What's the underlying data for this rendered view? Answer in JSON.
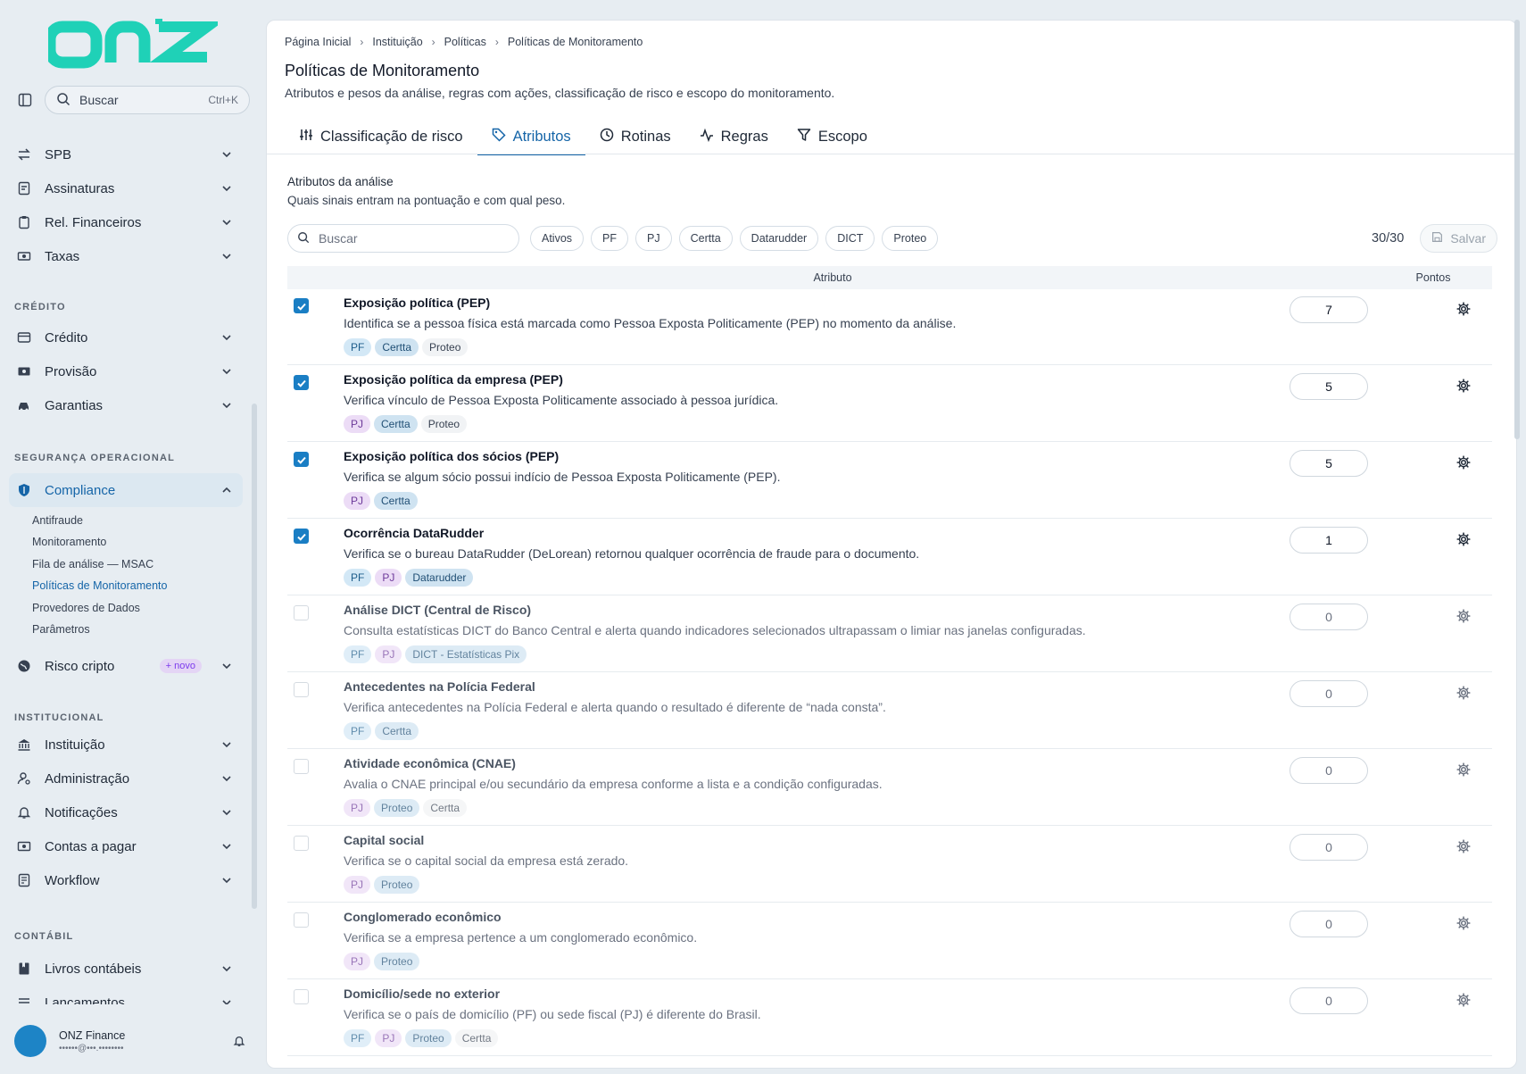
{
  "sidebar": {
    "logo_text": "onz",
    "search_label": "Buscar",
    "search_shortcut": "Ctrl+K",
    "top_items": [
      {
        "label": "SPB",
        "icon": "transfer-arrows-icon"
      },
      {
        "label": "Assinaturas",
        "icon": "signature-icon"
      },
      {
        "label": "Rel. Financeiros",
        "icon": "clipboard-icon"
      },
      {
        "label": "Taxas",
        "icon": "banknote-icon"
      }
    ],
    "section_credito": "CRÉDITO",
    "credito_items": [
      {
        "label": "Crédito",
        "icon": "card-icon"
      },
      {
        "label": "Provisão",
        "icon": "money-icon"
      },
      {
        "label": "Garantias",
        "icon": "car-icon"
      }
    ],
    "section_seguranca": "SEGURANÇA OPERACIONAL",
    "compliance_label": "Compliance",
    "compliance_sub": [
      "Antifraude",
      "Monitoramento",
      "Fila de análise — MSAC",
      "Políticas de Monitoramento",
      "Provedores de Dados",
      "Parâmetros"
    ],
    "risco_label": "Risco cripto",
    "risco_badge": "+ novo",
    "section_institucional": "INSTITUCIONAL",
    "institucional_items": [
      {
        "label": "Instituição",
        "icon": "bank-icon"
      },
      {
        "label": "Administração",
        "icon": "user-gear-icon"
      },
      {
        "label": "Notificações",
        "icon": "bell-icon"
      },
      {
        "label": "Contas a pagar",
        "icon": "bill-icon"
      },
      {
        "label": "Workflow",
        "icon": "workflow-icon"
      }
    ],
    "section_contabil": "CONTÁBIL",
    "contabil_items": [
      {
        "label": "Livros contábeis",
        "icon": "book-icon"
      },
      {
        "label": "Lançamentos",
        "icon": "list-icon"
      }
    ],
    "user_name": "ONZ Finance",
    "user_email": "••••••@•••.••••••••"
  },
  "breadcrumb": [
    "Página Inicial",
    "Instituição",
    "Políticas",
    "Políticas de Monitoramento"
  ],
  "page": {
    "title": "Políticas de Monitoramento",
    "subtitle": "Atributos e pesos da análise, regras com ações, classificação de risco e escopo do monitoramento."
  },
  "tabs": [
    {
      "label": "Classificação de risco",
      "icon": "sliders-icon"
    },
    {
      "label": "Atributos",
      "icon": "tag-icon"
    },
    {
      "label": "Rotinas",
      "icon": "clock-icon"
    },
    {
      "label": "Regras",
      "icon": "activity-icon"
    },
    {
      "label": "Escopo",
      "icon": "filter-icon"
    }
  ],
  "section": {
    "title": "Atributos da análise",
    "subtitle": "Quais sinais entram na pontuação e com qual peso."
  },
  "toolbar": {
    "search_placeholder": "Buscar",
    "chips": [
      "Ativos",
      "PF",
      "PJ",
      "Certta",
      "Datarudder",
      "DICT",
      "Proteo"
    ],
    "count": "30/30",
    "save_label": "Salvar"
  },
  "table": {
    "col_attr": "Atributo",
    "col_points": "Pontos",
    "rows": [
      {
        "title": "Exposição política (PEP)",
        "desc": "Identifica se a pessoa física está marcada como Pessoa Exposta Politicamente (PEP) no momento da análise.",
        "tags": [
          "PF",
          "Certta",
          "Proteo"
        ],
        "points": "7",
        "active": true
      },
      {
        "title": "Exposição política da empresa (PEP)",
        "desc": "Verifica vínculo de Pessoa Exposta Politicamente associado à pessoa jurídica.",
        "tags": [
          "PJ",
          "Certta",
          "Proteo"
        ],
        "points": "5",
        "active": true
      },
      {
        "title": "Exposição política dos sócios (PEP)",
        "desc": "Verifica se algum sócio possui indício de Pessoa Exposta Politicamente (PEP).",
        "tags": [
          "PJ",
          "Certta"
        ],
        "points": "5",
        "active": true
      },
      {
        "title": "Ocorrência DataRudder",
        "desc": "Verifica se o bureau DataRudder (DeLorean) retornou qualquer ocorrência de fraude para o documento.",
        "tags": [
          "PF",
          "PJ",
          "Datarudder"
        ],
        "points": "1",
        "active": true
      },
      {
        "title": "Análise DICT (Central de Risco)",
        "desc": "Consulta estatísticas DICT do Banco Central e alerta quando indicadores selecionados ultrapassam o limiar nas janelas configuradas.",
        "tags": [
          "PF",
          "PJ",
          "DICT - Estatísticas Pix"
        ],
        "points": "0",
        "active": false
      },
      {
        "title": "Antecedentes na Polícia Federal",
        "desc": "Verifica antecedentes na Polícia Federal e alerta quando o resultado é diferente de “nada consta”.",
        "tags": [
          "PF",
          "Certta"
        ],
        "points": "0",
        "active": false
      },
      {
        "title": "Atividade econômica (CNAE)",
        "desc": "Avalia o CNAE principal e/ou secundário da empresa conforme a lista e a condição configuradas.",
        "tags": [
          "PJ",
          "Proteo",
          "Certta"
        ],
        "points": "0",
        "active": false
      },
      {
        "title": "Capital social",
        "desc": "Verifica se o capital social da empresa está zerado.",
        "tags": [
          "PJ",
          "Proteo"
        ],
        "points": "0",
        "active": false
      },
      {
        "title": "Conglomerado econômico",
        "desc": "Verifica se a empresa pertence a um conglomerado econômico.",
        "tags": [
          "PJ",
          "Proteo"
        ],
        "points": "0",
        "active": false
      },
      {
        "title": "Domicílio/sede no exterior",
        "desc": "Verifica se o país de domicílio (PF) ou sede fiscal (PJ) é diferente do Brasil.",
        "tags": [
          "PF",
          "PJ",
          "Proteo",
          "Certta"
        ],
        "points": "0",
        "active": false
      }
    ]
  },
  "colors": {
    "accent": "#1565a8",
    "logo": "#1fd1b7",
    "checkbox": "#1a7ec4"
  }
}
